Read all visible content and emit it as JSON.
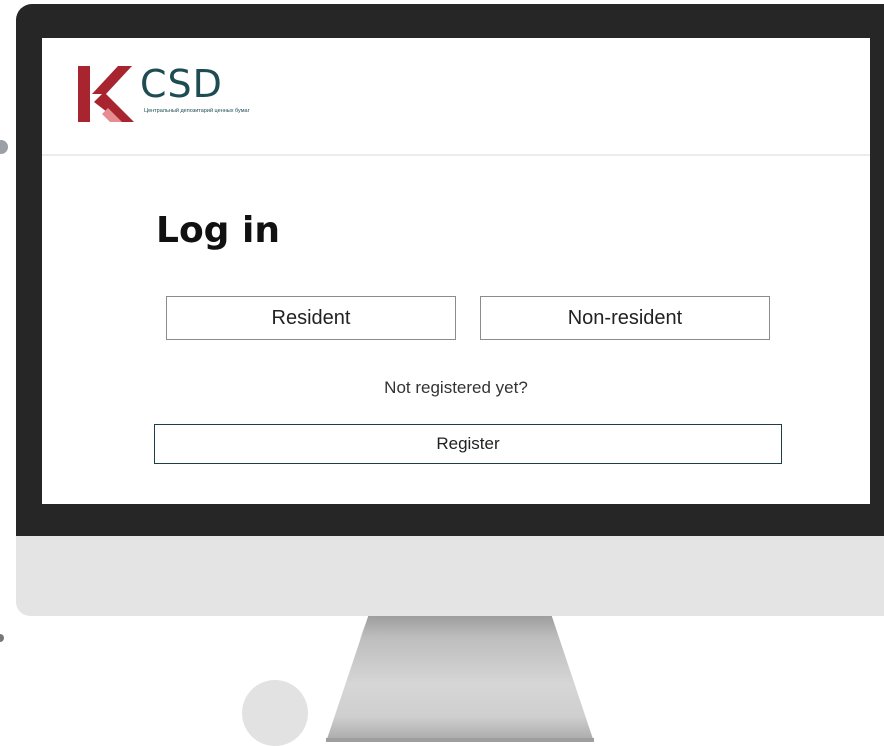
{
  "brand": {
    "name": "CSD",
    "subtitle": "Центральный депозитарий ценных бумаг",
    "colors": {
      "mark_red": "#a8242f",
      "word_teal": "#1d4c52"
    }
  },
  "login": {
    "title": "Log in",
    "resident_label": "Resident",
    "non_resident_label": "Non-resident",
    "not_registered_text": "Not registered yet?",
    "register_label": "Register"
  }
}
